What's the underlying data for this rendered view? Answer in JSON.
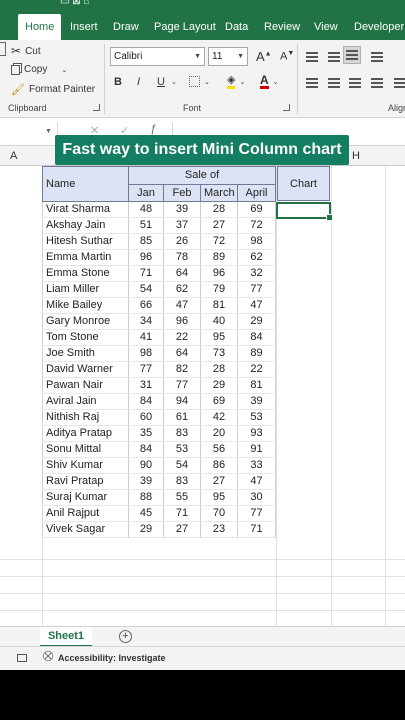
{
  "ribbon_tabs": [
    "Home",
    "Insert",
    "Draw",
    "Page Layout",
    "Data",
    "Review",
    "View",
    "Developer"
  ],
  "active_tab": "Home",
  "clipboard": {
    "cut": "Cut",
    "copy": "Copy",
    "format_painter": "Format Painter",
    "group_label": "Clipboard"
  },
  "font": {
    "family": "Calibri",
    "size": "11",
    "bold": "B",
    "italic": "I",
    "underline": "U",
    "font_color_glyph": "A",
    "group_label": "Font"
  },
  "alignment": {
    "group_label": "Align"
  },
  "column_headers": {
    "a": "A",
    "h": "H"
  },
  "banner": {
    "title": "Fast way to insert Mini Column chart"
  },
  "table": {
    "name_header": "Name",
    "sale_of_header": "Sale of",
    "months": [
      "Jan",
      "Feb",
      "March",
      "April"
    ],
    "chart_header": "Chart",
    "rows": [
      {
        "name": "Virat Sharma",
        "values": [
          48,
          39,
          28,
          69
        ]
      },
      {
        "name": "Akshay Jain",
        "values": [
          51,
          37,
          27,
          72
        ]
      },
      {
        "name": "Hitesh Suthar",
        "values": [
          85,
          26,
          72,
          98
        ]
      },
      {
        "name": "Emma Martin",
        "values": [
          96,
          78,
          89,
          62
        ]
      },
      {
        "name": "Emma Stone",
        "values": [
          71,
          64,
          96,
          32
        ]
      },
      {
        "name": "Liam Miller",
        "values": [
          54,
          62,
          79,
          77
        ]
      },
      {
        "name": "Mike Bailey",
        "values": [
          66,
          47,
          81,
          47
        ]
      },
      {
        "name": "Gary Monroe",
        "values": [
          34,
          96,
          40,
          29
        ]
      },
      {
        "name": "Tom Stone",
        "values": [
          41,
          22,
          95,
          84
        ]
      },
      {
        "name": "Joe Smith",
        "values": [
          98,
          64,
          73,
          89
        ]
      },
      {
        "name": "David Warner",
        "values": [
          77,
          82,
          28,
          22
        ]
      },
      {
        "name": "Pawan Nair",
        "values": [
          31,
          77,
          29,
          81
        ]
      },
      {
        "name": "Aviral Jain",
        "values": [
          84,
          94,
          69,
          39
        ]
      },
      {
        "name": "Nithish Raj",
        "values": [
          60,
          61,
          42,
          53
        ]
      },
      {
        "name": "Aditya Pratap",
        "values": [
          35,
          83,
          20,
          93
        ]
      },
      {
        "name": "Sonu Mittal",
        "values": [
          84,
          53,
          56,
          91
        ]
      },
      {
        "name": "Shiv Kumar",
        "values": [
          90,
          54,
          86,
          33
        ]
      },
      {
        "name": "Ravi Pratap",
        "values": [
          39,
          83,
          27,
          47
        ]
      },
      {
        "name": "Suraj Kumar",
        "values": [
          88,
          55,
          95,
          30
        ]
      },
      {
        "name": "Anil Rajput",
        "values": [
          45,
          71,
          70,
          77
        ]
      },
      {
        "name": "Vivek Sagar",
        "values": [
          29,
          27,
          23,
          71
        ]
      }
    ]
  },
  "sheet_tab": "Sheet1",
  "status": {
    "accessibility": "Accessibility: Investigate"
  },
  "colors": {
    "brand": "#217346",
    "banner": "#147e63",
    "header_fill": "#dde3f4"
  }
}
